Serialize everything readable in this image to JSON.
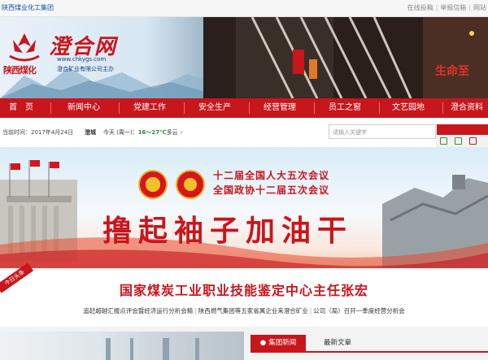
{
  "topbar": {
    "group_link": "陕西煤业化工集团",
    "right_links": [
      "在线投稿",
      "举报信箱",
      "网站"
    ]
  },
  "header": {
    "logo_cn": "陕西煤化",
    "site_title": "澄合网",
    "site_url": "www.chkygs.com",
    "site_sub": "澄合矿业有限公司主办",
    "tunnel_text": "生命至"
  },
  "nav": [
    "首　页",
    "新闻中心",
    "党建工作",
    "安全生产",
    "经营管理",
    "员工之窗",
    "文艺园地",
    "澄合资料"
  ],
  "info": {
    "date_label": "当前时间：2017年4月24日",
    "city": "澄城",
    "weather_day": "今天 (周一)：",
    "temp": "16～27℃",
    "weather_desc": "多云",
    "arrow": "»",
    "search_placeholder": "请输入关键字"
  },
  "banner": {
    "line1": "十二届全国人大五次会议",
    "line2": "全国政协十二届五次会议",
    "slogan": "撸起袖子加油干"
  },
  "headline": {
    "ribbon": "今日头条",
    "title": "国家煤炭工业职业技能鉴定中心主任张宏",
    "sub_items": [
      "追赶超越汇报点评会暨经济运行分析会精",
      "陕西燃气集团等五家省属企业来澄合矿业",
      "公司（局）召开一季度经营分析会"
    ]
  },
  "tabs": {
    "active": "集团新闻",
    "inactive": "最新文章"
  }
}
